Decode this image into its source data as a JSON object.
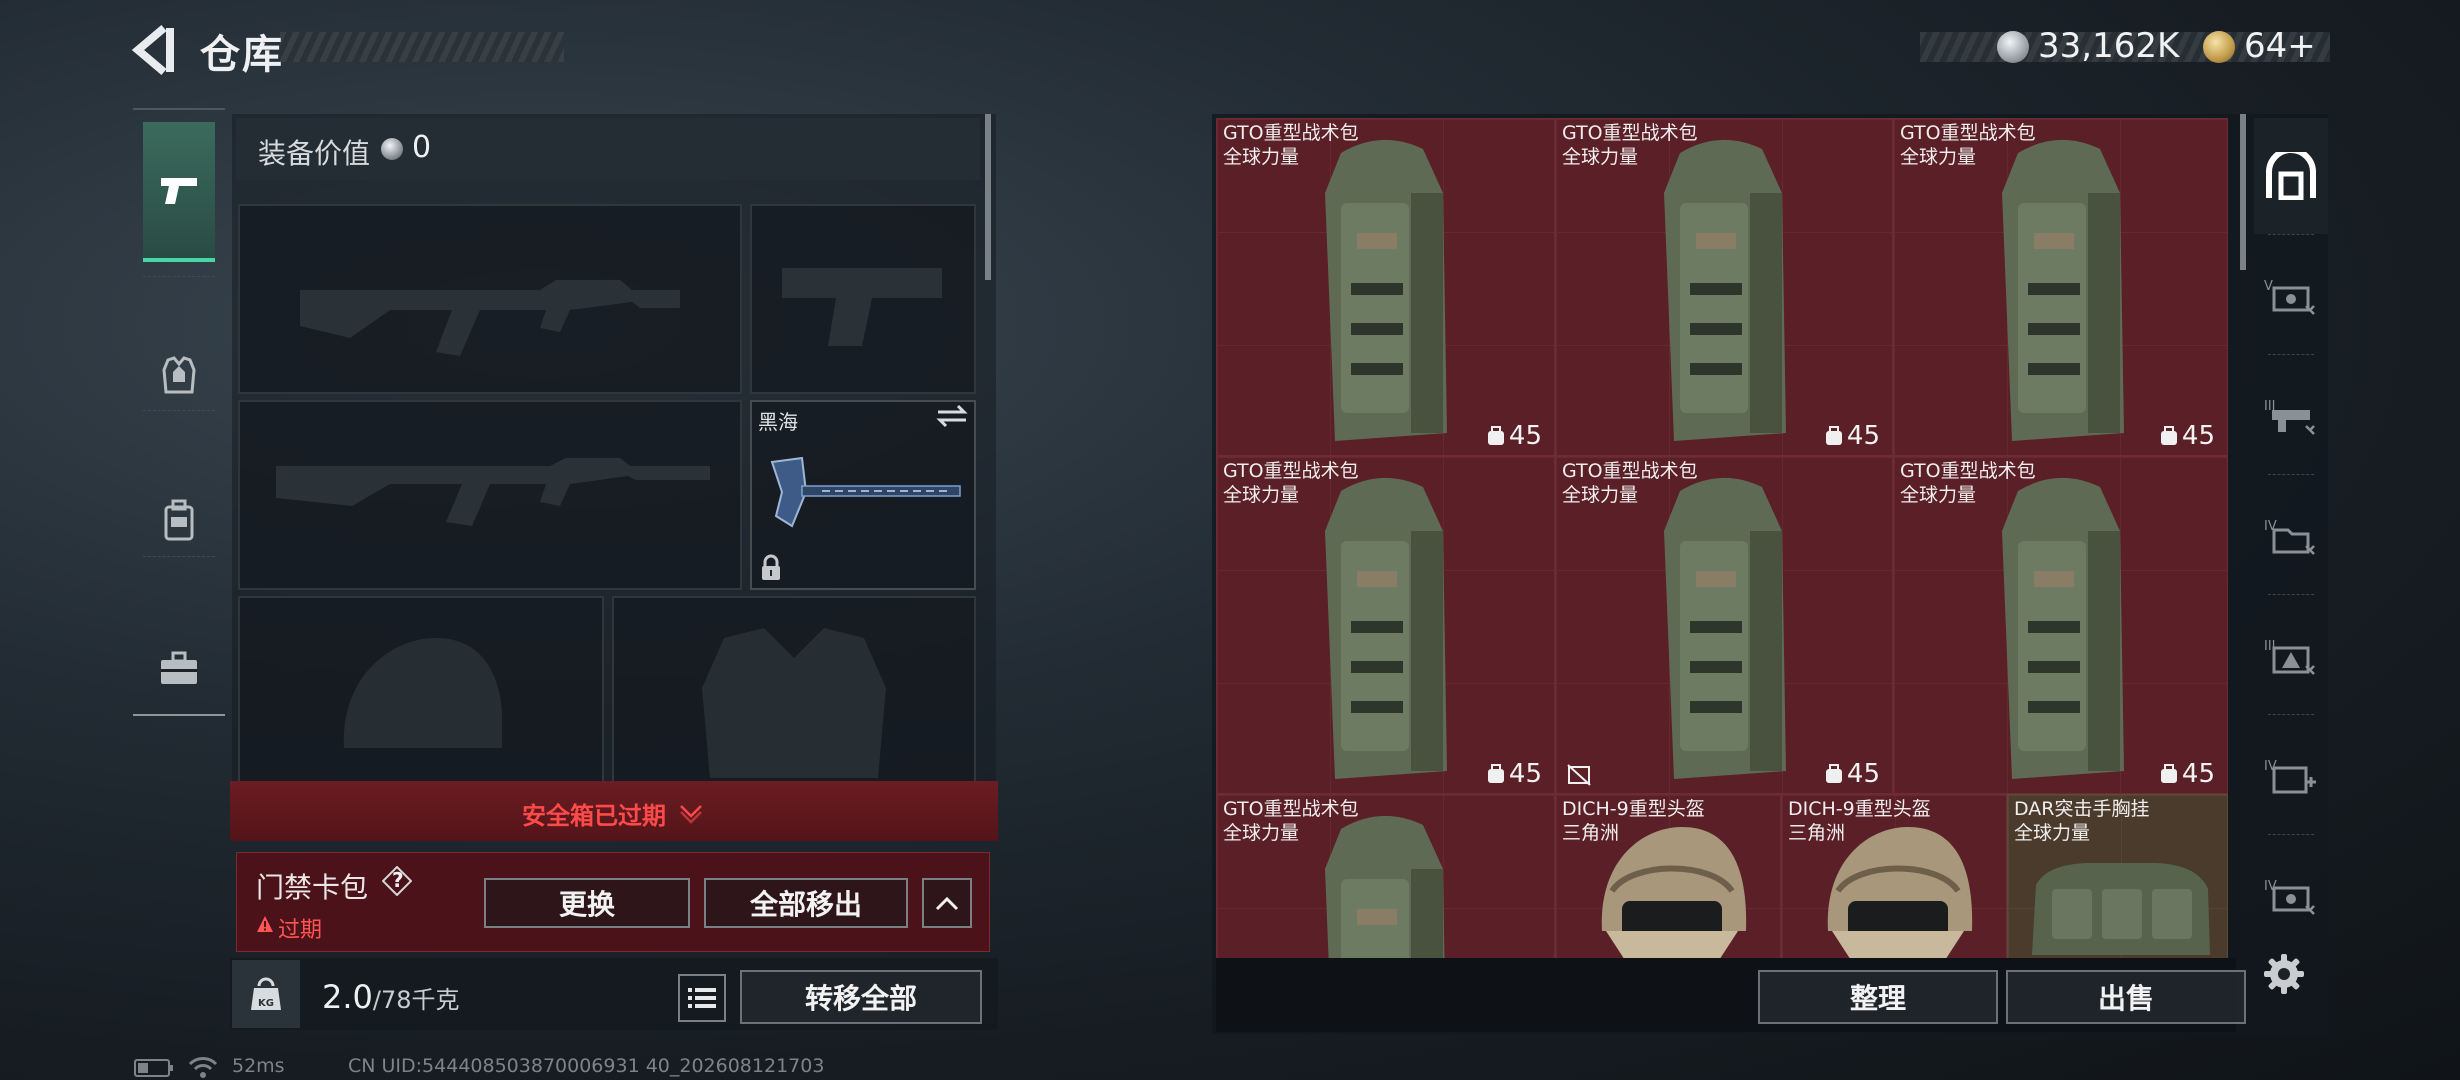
{
  "header": {
    "title": "仓库",
    "currency_silver": "33,162K",
    "currency_gold": "64+"
  },
  "left_tabs": [
    {
      "name": "weapons",
      "icon": "pistol-icon",
      "active": true
    },
    {
      "name": "armor",
      "icon": "vest-icon",
      "active": false
    },
    {
      "name": "backpack",
      "icon": "backpack-icon",
      "active": false
    },
    {
      "name": "case",
      "icon": "briefcase-icon",
      "active": false
    }
  ],
  "equipment": {
    "label": "装备价值",
    "value": "0",
    "melee_name": "黑海"
  },
  "safebox": {
    "status_text": "安全箱已过期",
    "card_name": "门禁卡包",
    "card_help": "?",
    "card_status": "过期",
    "replace_label": "更换",
    "remove_all_label": "全部移出"
  },
  "weight": {
    "current": "2.0",
    "max": "/78千克",
    "transfer_all_label": "转移全部"
  },
  "status_bar": {
    "ping": "52ms",
    "uid": "CN UID:544408503870006931 40_202608121703"
  },
  "stash": {
    "items": [
      {
        "name": "GTO重型战术包",
        "source": "全球力量",
        "capacity": "45",
        "kind": "backpack"
      },
      {
        "name": "GTO重型战术包",
        "source": "全球力量",
        "capacity": "45",
        "kind": "backpack"
      },
      {
        "name": "GTO重型战术包",
        "source": "全球力量",
        "capacity": "45",
        "kind": "backpack"
      },
      {
        "name": "GTO重型战术包",
        "source": "全球力量",
        "capacity": "45",
        "kind": "backpack"
      },
      {
        "name": "GTO重型战术包",
        "source": "全球力量",
        "capacity": "45",
        "kind": "backpack"
      },
      {
        "name": "GTO重型战术包",
        "source": "全球力量",
        "capacity": "45",
        "kind": "backpack"
      },
      {
        "name": "GTO重型战术包",
        "source": "全球力量",
        "capacity": "",
        "kind": "backpack"
      },
      {
        "name": "DICH-9重型头盔",
        "source": "三角洲",
        "capacity": "",
        "kind": "helmet"
      },
      {
        "name": "DICH-9重型头盔",
        "source": "三角洲",
        "capacity": "",
        "kind": "helmet"
      },
      {
        "name": "DAR突击手胸挂",
        "source": "全球力量",
        "capacity": "",
        "kind": "rig"
      }
    ],
    "sort_label": "整理",
    "sell_label": "出售"
  },
  "page_tabs": [
    "home",
    "V",
    "III",
    "IV",
    "III",
    "IV",
    "IV"
  ]
}
